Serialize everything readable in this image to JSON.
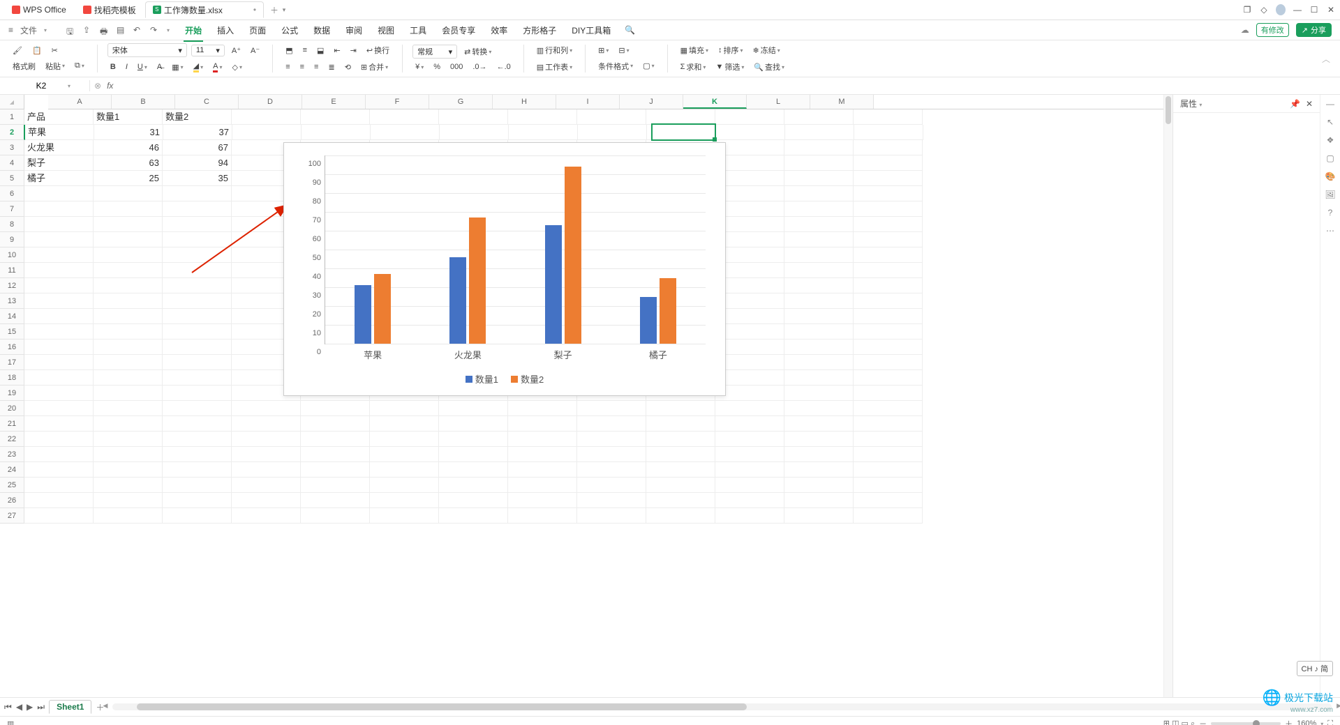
{
  "app": {
    "name": "WPS Office"
  },
  "tabs": [
    {
      "label": "找稻壳模板",
      "icon_color": "#f2473f",
      "active": false
    },
    {
      "label": "工作簿数量.xlsx",
      "icon_color": "#1a9e5c",
      "active": true
    }
  ],
  "titlebar_icons": [
    "window-multi-icon",
    "cube-icon",
    "avatar-icon",
    "minimize-icon",
    "maximize-icon",
    "close-icon"
  ],
  "filemenu": {
    "label": "文件"
  },
  "quick_icons": [
    "save-icon",
    "print-icon",
    "preview-icon",
    "undo-icon",
    "redo-icon"
  ],
  "menu": {
    "items": [
      "开始",
      "插入",
      "页面",
      "公式",
      "数据",
      "审阅",
      "视图",
      "工具",
      "会员专享",
      "效率",
      "方形格子",
      "DIY工具箱"
    ],
    "active_index": 0,
    "search_icon": "search-icon",
    "right": {
      "changes": "有修改",
      "share": "分享"
    }
  },
  "ribbon": {
    "format_painter": "格式刷",
    "paste": "粘贴",
    "font_name": "宋体",
    "font_size": "11",
    "wrap": "换行",
    "merge": "合并",
    "number_format": "常规",
    "convert": "转换",
    "rowcol": "行和列",
    "worksheet": "工作表",
    "cond_format": "条件格式",
    "fill": "填充",
    "sort": "排序",
    "freeze": "冻结",
    "sum": "求和",
    "filter": "筛选",
    "find": "查找"
  },
  "name_box": "K2",
  "formula_bar": "",
  "columns": [
    "A",
    "B",
    "C",
    "D",
    "E",
    "F",
    "G",
    "H",
    "I",
    "J",
    "K",
    "L",
    "M"
  ],
  "selected_col_index": 10,
  "row_count": 27,
  "selected_row": 2,
  "table": {
    "headers": [
      "产品",
      "数量1",
      "数量2"
    ],
    "rows": [
      [
        "苹果",
        31,
        37
      ],
      [
        "火龙果",
        46,
        67
      ],
      [
        "梨子",
        63,
        94
      ],
      [
        "橘子",
        25,
        35
      ]
    ]
  },
  "chart_data": {
    "type": "bar",
    "categories": [
      "苹果",
      "火龙果",
      "梨子",
      "橘子"
    ],
    "series": [
      {
        "name": "数量1",
        "values": [
          31,
          46,
          63,
          25
        ],
        "color": "#4472c4"
      },
      {
        "name": "数量2",
        "values": [
          37,
          67,
          94,
          35
        ],
        "color": "#ed7d31"
      }
    ],
    "yticks": [
      0,
      10,
      20,
      30,
      40,
      50,
      60,
      70,
      80,
      90,
      100
    ],
    "ylim": [
      0,
      100
    ],
    "legend_position": "bottom"
  },
  "right_panel": {
    "title": "属性"
  },
  "side_tools": [
    "cursor-icon",
    "layers-icon",
    "box-icon",
    "paint-icon",
    "image-icon",
    "help-icon",
    "more-icon"
  ],
  "sheet_tabs": {
    "items": [
      "Sheet1"
    ],
    "active": 0
  },
  "statusbar": {
    "left_icon": "grid-icon",
    "zoom": "160%"
  },
  "ime_badge": "CH ♪ 简",
  "watermark": {
    "main": "极光下载站",
    "sub": "www.xz7.com"
  },
  "colors": {
    "series1": "#4472c4",
    "series2": "#ed7d31",
    "accent": "#1a9e5c"
  }
}
